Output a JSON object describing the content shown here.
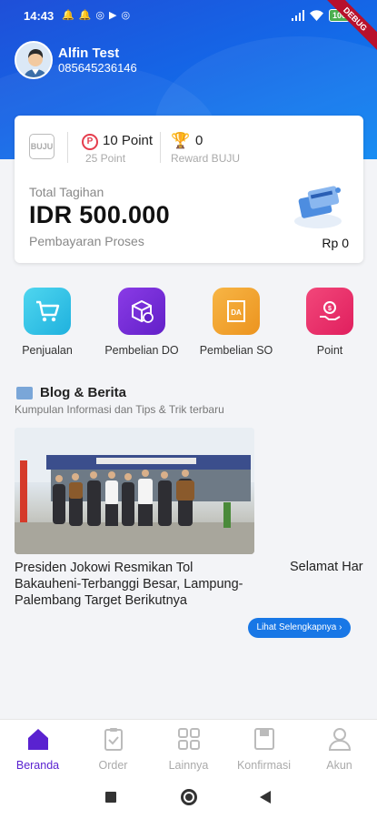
{
  "status_bar": {
    "time": "14:43",
    "battery": "100",
    "debug_label": "DEBUG"
  },
  "profile": {
    "name": "Alfin Test",
    "phone": "085645236146"
  },
  "summary_card": {
    "brand_logo": "BUJU",
    "point_value": "10 Point",
    "point_sub": "25 Point",
    "reward_value": "0",
    "reward_sub": "Reward BUJU",
    "total_label": "Total Tagihan",
    "total_value": "IDR 500.000",
    "status_text": "Pembayaran Proses",
    "balance": "Rp 0"
  },
  "menu": [
    {
      "label": "Penjualan",
      "icon": "cart-icon",
      "color": "#2ec4e6"
    },
    {
      "label": "Pembelian DO",
      "icon": "box-icon",
      "color": "#7a2bd6"
    },
    {
      "label": "Pembelian SO",
      "icon": "da-box-icon",
      "color": "#f0a12a"
    },
    {
      "label": "Point",
      "icon": "coin-hand-icon",
      "color": "#ea2b6a"
    }
  ],
  "blog": {
    "title": "Blog & Berita",
    "subtitle": "Kumpulan Informasi dan Tips & Trik terbaru",
    "items": [
      {
        "title": "Presiden Jokowi Resmikan Tol Bakauheni-Terbanggi Besar, Lampung-Palembang Target Berikutnya"
      },
      {
        "title": "Selamat Har"
      }
    ],
    "more_label": "Lihat Selengkapnya ›"
  },
  "bottom_nav": [
    {
      "label": "Beranda",
      "icon": "home-icon",
      "active": true
    },
    {
      "label": "Order",
      "icon": "clipboard-icon",
      "active": false
    },
    {
      "label": "Lainnya",
      "icon": "grid-icon",
      "active": false
    },
    {
      "label": "Konfirmasi",
      "icon": "inbox-icon",
      "active": false
    },
    {
      "label": "Akun",
      "icon": "user-icon",
      "active": false
    }
  ],
  "colors": {
    "header_blue": "#1565e6",
    "accent_purple": "#5a22d0",
    "button_blue": "#1877e6"
  }
}
